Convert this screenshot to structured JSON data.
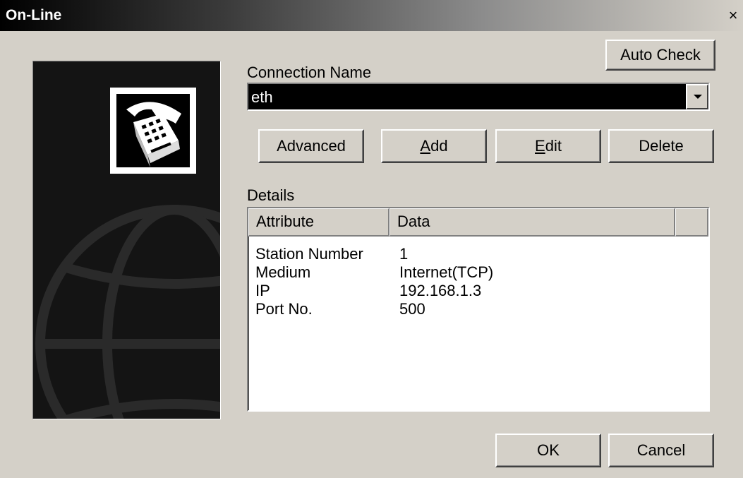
{
  "window": {
    "title": "On-Line",
    "close_glyph": "×"
  },
  "side_panel": {
    "icon": "telephone-icon",
    "background_icon": "globe-icon"
  },
  "connection": {
    "label": "Connection Name",
    "selected": "eth"
  },
  "buttons": {
    "auto_check": "Auto Check",
    "advanced": "Advanced",
    "add_mnemonic": "A",
    "add_rest": "dd",
    "edit_mnemonic": "E",
    "edit_rest": "dit",
    "delete": "Delete",
    "ok": "OK",
    "cancel": "Cancel"
  },
  "details": {
    "label": "Details",
    "columns": [
      "Attribute",
      "Data"
    ],
    "rows": [
      {
        "attribute": "Station Number",
        "data": "1"
      },
      {
        "attribute": "Medium",
        "data": "Internet(TCP)"
      },
      {
        "attribute": "IP",
        "data": "192.168.1.3"
      },
      {
        "attribute": "Port No.",
        "data": "500"
      }
    ]
  },
  "colors": {
    "dialog_bg": "#d4d0c8",
    "titlebar_start": "#000000",
    "titlebar_end": "#d4d0c8",
    "selection_bg": "#000000",
    "panel_bg": "#141414"
  }
}
